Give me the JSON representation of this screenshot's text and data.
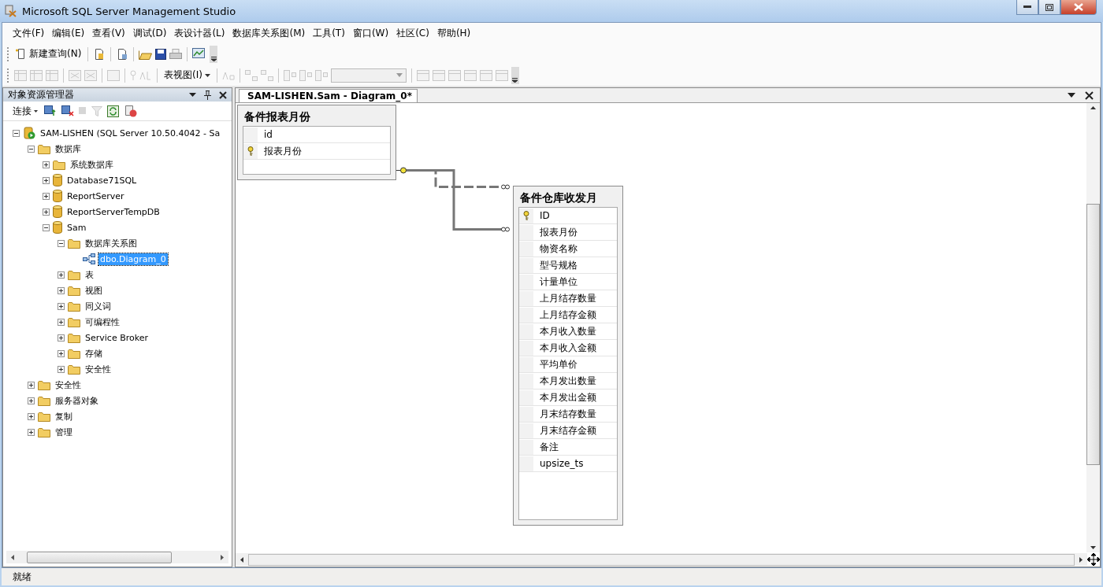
{
  "window": {
    "title": "Microsoft SQL Server Management Studio"
  },
  "menu": [
    "文件(F)",
    "编辑(E)",
    "查看(V)",
    "调试(D)",
    "表设计器(L)",
    "数据库关系图(M)",
    "工具(T)",
    "窗口(W)",
    "社区(C)",
    "帮助(H)"
  ],
  "toolbar": {
    "new_query": "新建查询(N)",
    "view_dropdown": "表视图(I)"
  },
  "explorer": {
    "title": "对象资源管理器",
    "connect": "连接",
    "tree": [
      {
        "label": "SAM-LISHEN (SQL Server 10.50.4042 - Sa",
        "kind": "server",
        "expanded": true,
        "selected": false,
        "children": [
          {
            "label": "数据库",
            "kind": "folder",
            "expanded": true,
            "selected": false,
            "children": [
              {
                "label": "系统数据库",
                "kind": "folder",
                "expanded": false,
                "selected": false
              },
              {
                "label": "Database71SQL",
                "kind": "database",
                "expanded": false,
                "selected": false
              },
              {
                "label": "ReportServer",
                "kind": "database",
                "expanded": false,
                "selected": false
              },
              {
                "label": "ReportServerTempDB",
                "kind": "database",
                "expanded": false,
                "selected": false
              },
              {
                "label": "Sam",
                "kind": "database",
                "expanded": true,
                "selected": false,
                "children": [
                  {
                    "label": "数据库关系图",
                    "kind": "folder",
                    "expanded": true,
                    "selected": false,
                    "children": [
                      {
                        "label": "dbo.Diagram_0",
                        "kind": "diagram",
                        "selected": true
                      }
                    ]
                  },
                  {
                    "label": "表",
                    "kind": "folder",
                    "expanded": false,
                    "selected": false
                  },
                  {
                    "label": "视图",
                    "kind": "folder",
                    "expanded": false,
                    "selected": false
                  },
                  {
                    "label": "同义词",
                    "kind": "folder",
                    "expanded": false,
                    "selected": false
                  },
                  {
                    "label": "可编程性",
                    "kind": "folder",
                    "expanded": false,
                    "selected": false
                  },
                  {
                    "label": "Service Broker",
                    "kind": "folder",
                    "expanded": false,
                    "selected": false
                  },
                  {
                    "label": "存储",
                    "kind": "folder",
                    "expanded": false,
                    "selected": false
                  },
                  {
                    "label": "安全性",
                    "kind": "folder",
                    "expanded": false,
                    "selected": false
                  }
                ]
              }
            ]
          },
          {
            "label": "安全性",
            "kind": "folder",
            "expanded": false,
            "selected": false
          },
          {
            "label": "服务器对象",
            "kind": "folder",
            "expanded": false,
            "selected": false
          },
          {
            "label": "复制",
            "kind": "folder",
            "expanded": false,
            "selected": false
          },
          {
            "label": "管理",
            "kind": "folder",
            "expanded": false,
            "selected": false
          }
        ]
      }
    ]
  },
  "document": {
    "tab": "SAM-LISHEN.Sam - Diagram_0*",
    "tables": [
      {
        "title": "备件报表月份",
        "columns": [
          {
            "name": "id",
            "primary_key": false
          },
          {
            "name": "报表月份",
            "primary_key": true
          }
        ]
      },
      {
        "title": "备件仓库收发月",
        "columns": [
          {
            "name": "ID",
            "primary_key": true
          },
          {
            "name": "报表月份",
            "primary_key": false
          },
          {
            "name": "物资名称",
            "primary_key": false
          },
          {
            "name": "型号规格",
            "primary_key": false
          },
          {
            "name": "计量单位",
            "primary_key": false
          },
          {
            "name": "上月结存数量",
            "primary_key": false
          },
          {
            "name": "上月结存金额",
            "primary_key": false
          },
          {
            "name": "本月收入数量",
            "primary_key": false
          },
          {
            "name": "本月收入金额",
            "primary_key": false
          },
          {
            "name": "平均单价",
            "primary_key": false
          },
          {
            "name": "本月发出数量",
            "primary_key": false
          },
          {
            "name": "本月发出金额",
            "primary_key": false
          },
          {
            "name": "月末结存数量",
            "primary_key": false
          },
          {
            "name": "月末结存金额",
            "primary_key": false
          },
          {
            "name": "备注",
            "primary_key": false
          },
          {
            "name": "upsize_ts",
            "primary_key": false
          }
        ]
      }
    ]
  },
  "status_bar": {
    "text": "就绪"
  }
}
